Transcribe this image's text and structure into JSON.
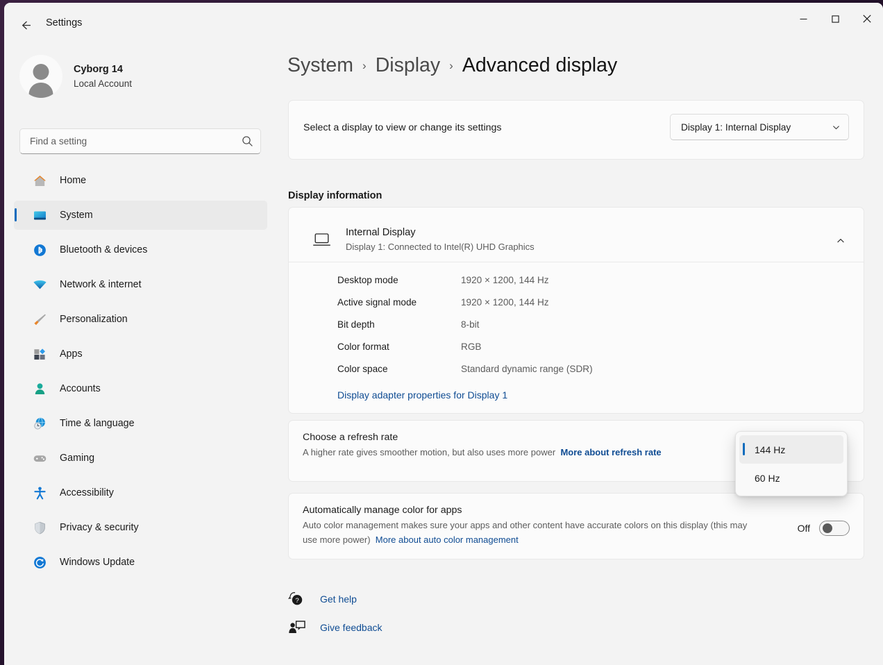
{
  "window": {
    "title": "Settings",
    "back_icon": "back-arrow-icon",
    "minimize_label": "Minimize",
    "maximize_label": "Maximize",
    "close_label": "Close"
  },
  "account": {
    "name": "Cyborg 14",
    "subtitle": "Local Account",
    "avatar_icon": "person-avatar-icon"
  },
  "search": {
    "placeholder": "Find a setting",
    "icon": "search-icon"
  },
  "sidebar": {
    "items": [
      {
        "label": "Home",
        "icon": "home-icon",
        "selected": false
      },
      {
        "label": "System",
        "icon": "monitor-icon",
        "selected": true
      },
      {
        "label": "Bluetooth & devices",
        "icon": "bluetooth-icon",
        "selected": false
      },
      {
        "label": "Network & internet",
        "icon": "wifi-icon",
        "selected": false
      },
      {
        "label": "Personalization",
        "icon": "paintbrush-icon",
        "selected": false
      },
      {
        "label": "Apps",
        "icon": "apps-icon",
        "selected": false
      },
      {
        "label": "Accounts",
        "icon": "accounts-person-icon",
        "selected": false
      },
      {
        "label": "Time & language",
        "icon": "clock-globe-icon",
        "selected": false
      },
      {
        "label": "Gaming",
        "icon": "gamepad-icon",
        "selected": false
      },
      {
        "label": "Accessibility",
        "icon": "accessibility-person-icon",
        "selected": false
      },
      {
        "label": "Privacy & security",
        "icon": "shield-icon",
        "selected": false
      },
      {
        "label": "Windows Update",
        "icon": "update-refresh-icon",
        "selected": false
      }
    ]
  },
  "breadcrumb": {
    "items": [
      {
        "label": "System",
        "current": false
      },
      {
        "label": "Display",
        "current": false
      },
      {
        "label": "Advanced display",
        "current": true
      }
    ],
    "separator": "›"
  },
  "display_selector": {
    "label": "Select a display to view or change its settings",
    "value": "Display 1: Internal Display",
    "chevron_icon": "chevron-down-icon"
  },
  "display_information": {
    "section_title": "Display information",
    "device_name": "Internal Display",
    "device_subtitle": "Display 1: Connected to Intel(R) UHD Graphics",
    "device_icon": "laptop-icon",
    "expand_icon": "chevron-up-icon",
    "rows": [
      {
        "label": "Desktop mode",
        "value": "1920 × 1200, 144 Hz"
      },
      {
        "label": "Active signal mode",
        "value": "1920 × 1200, 144 Hz"
      },
      {
        "label": "Bit depth",
        "value": "8-bit"
      },
      {
        "label": "Color format",
        "value": "RGB"
      },
      {
        "label": "Color space",
        "value": "Standard dynamic range (SDR)"
      }
    ],
    "adapter_link": "Display adapter properties for Display 1"
  },
  "refresh_rate": {
    "title": "Choose a refresh rate",
    "description": "A higher rate gives smoother motion, but also uses more power",
    "link": "More about refresh rate",
    "dropdown_open": true,
    "options": [
      {
        "label": "144 Hz",
        "selected": true
      },
      {
        "label": "60 Hz",
        "selected": false
      }
    ]
  },
  "auto_color": {
    "title": "Automatically manage color for apps",
    "description": "Auto color management makes sure your apps and other content have accurate colors on this display (this may use more power)",
    "link": "More about auto color management",
    "toggle_state": "Off"
  },
  "footer": {
    "links": [
      {
        "label": "Get help",
        "icon": "help-question-icon"
      },
      {
        "label": "Give feedback",
        "icon": "feedback-icon"
      }
    ]
  },
  "colors": {
    "accent": "#0f6cbd",
    "link": "#0f4c93",
    "page_bg": "#f3f3f3",
    "card_bg": "#fbfbfb"
  }
}
